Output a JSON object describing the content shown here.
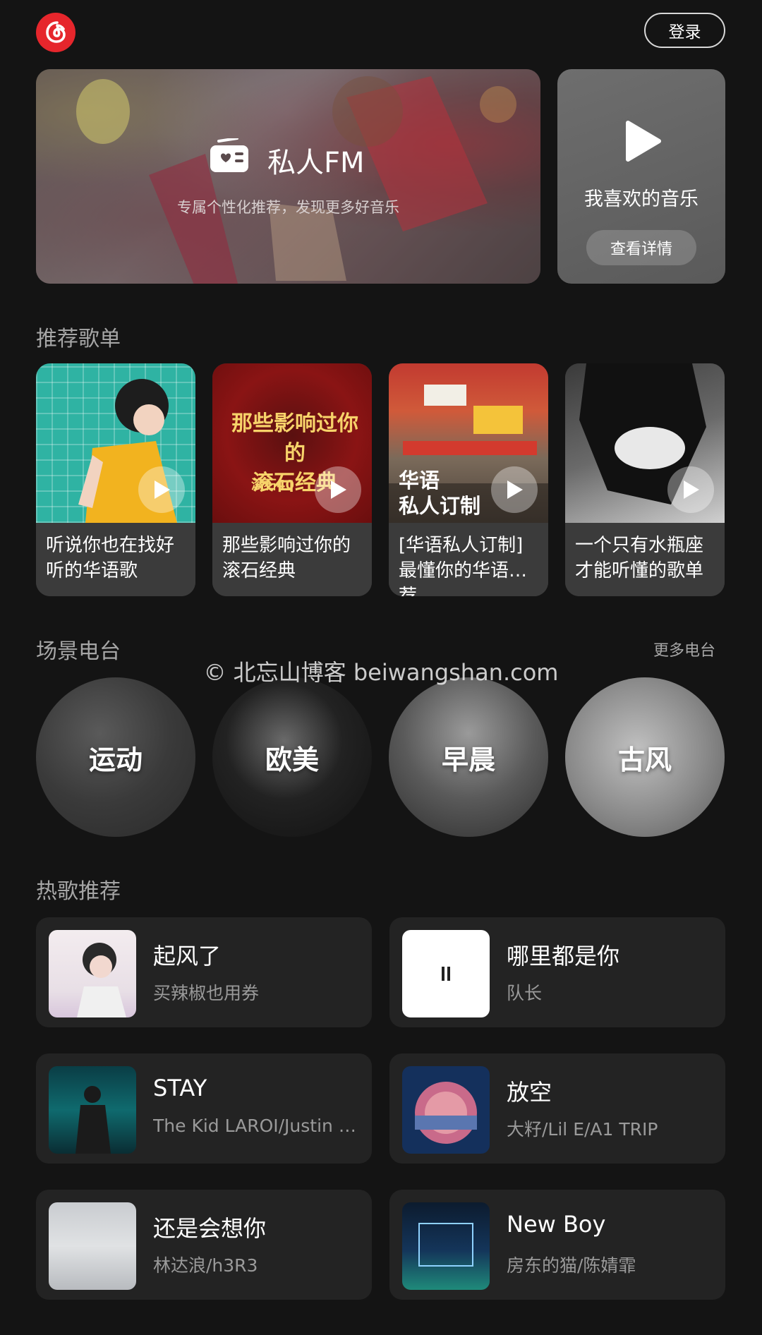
{
  "header": {
    "login_label": "登录",
    "accent_color": "#e6262c"
  },
  "fm": {
    "title": "私人FM",
    "subtitle": "专属个性化推荐，发现更多好音乐"
  },
  "favorites": {
    "title": "我喜欢的音乐",
    "button_label": "查看详情"
  },
  "recommended": {
    "title": "推荐歌单",
    "playlists": [
      {
        "label": "听说你也在找好听的华语歌"
      },
      {
        "label": "那些影响过你的滚石经典",
        "cover_text": "那些影响过你的\n滚石经典",
        "cover_badge": "滚石40"
      },
      {
        "label": "[华语私人订制] 最懂你的华语推荐",
        "cover_text": "华语\n私人订制"
      },
      {
        "label": "一个只有水瓶座才能听懂的歌单"
      }
    ]
  },
  "stations": {
    "title": "场景电台",
    "more_label": "更多电台",
    "items": [
      {
        "label": "运动"
      },
      {
        "label": "欧美"
      },
      {
        "label": "早晨"
      },
      {
        "label": "古风"
      }
    ]
  },
  "watermark": "© 北忘山博客 beiwangshan.com",
  "hot_songs": {
    "title": "热歌推荐",
    "items": [
      {
        "title": "起风了",
        "artist": "买辣椒也用券"
      },
      {
        "title": "哪里都是你",
        "artist": "队长",
        "playing": true
      },
      {
        "title": "STAY",
        "artist": "The Kid LAROI/Justin Bieber"
      },
      {
        "title": "放空",
        "artist": "大籽/Lil E/A1 TRIP"
      },
      {
        "title": "还是会想你",
        "artist": "林达浪/h3R3"
      },
      {
        "title": "New Boy",
        "artist": "房东的猫/陈婧霏"
      }
    ]
  }
}
